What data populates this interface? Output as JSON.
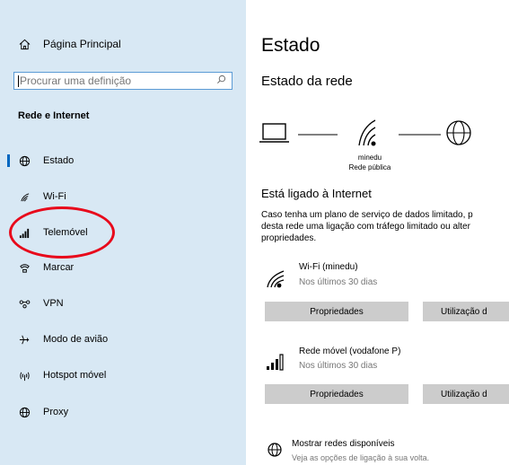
{
  "sidebar": {
    "home_label": "Página Principal",
    "search_placeholder": "Procurar uma definição",
    "section_title": "Rede e Internet",
    "items": [
      {
        "label": "Estado",
        "icon": "globe-icon"
      },
      {
        "label": "Wi-Fi",
        "icon": "wifi-icon"
      },
      {
        "label": "Telemóvel",
        "icon": "cellular-icon"
      },
      {
        "label": "Marcar",
        "icon": "dialup-icon"
      },
      {
        "label": "VPN",
        "icon": "vpn-icon"
      },
      {
        "label": "Modo de avião",
        "icon": "airplane-icon"
      },
      {
        "label": "Hotspot móvel",
        "icon": "hotspot-icon"
      },
      {
        "label": "Proxy",
        "icon": "globe-icon"
      }
    ]
  },
  "main": {
    "title": "Estado",
    "subtitle": "Estado da rede",
    "network_name": "minedu",
    "network_type": "Rede pública",
    "connected_heading": "Está ligado à Internet",
    "paragraph": [
      "Caso tenha um plano de serviço de dados limitado, p",
      "desta rede uma ligação com tráfego limitado ou alter",
      "propriedades."
    ],
    "connections": [
      {
        "name": "Wi-Fi (minedu)",
        "sub": "Nos últimos 30 dias",
        "btn_props": "Propriedades",
        "btn_usage": "Utilização d"
      },
      {
        "name": "Rede móvel (vodafone P)",
        "sub": "Nos últimos 30 dias",
        "btn_props": "Propriedades",
        "btn_usage": "Utilização d"
      }
    ],
    "show_networks": "Mostrar redes disponíveis",
    "show_networks_sub": "Veja as opções de ligação à sua volta."
  },
  "colors": {
    "sidebar_bg": "#d8e8f4",
    "accent": "#0067c0",
    "annotation": "#e8091b",
    "button_bg": "#cccccc"
  }
}
